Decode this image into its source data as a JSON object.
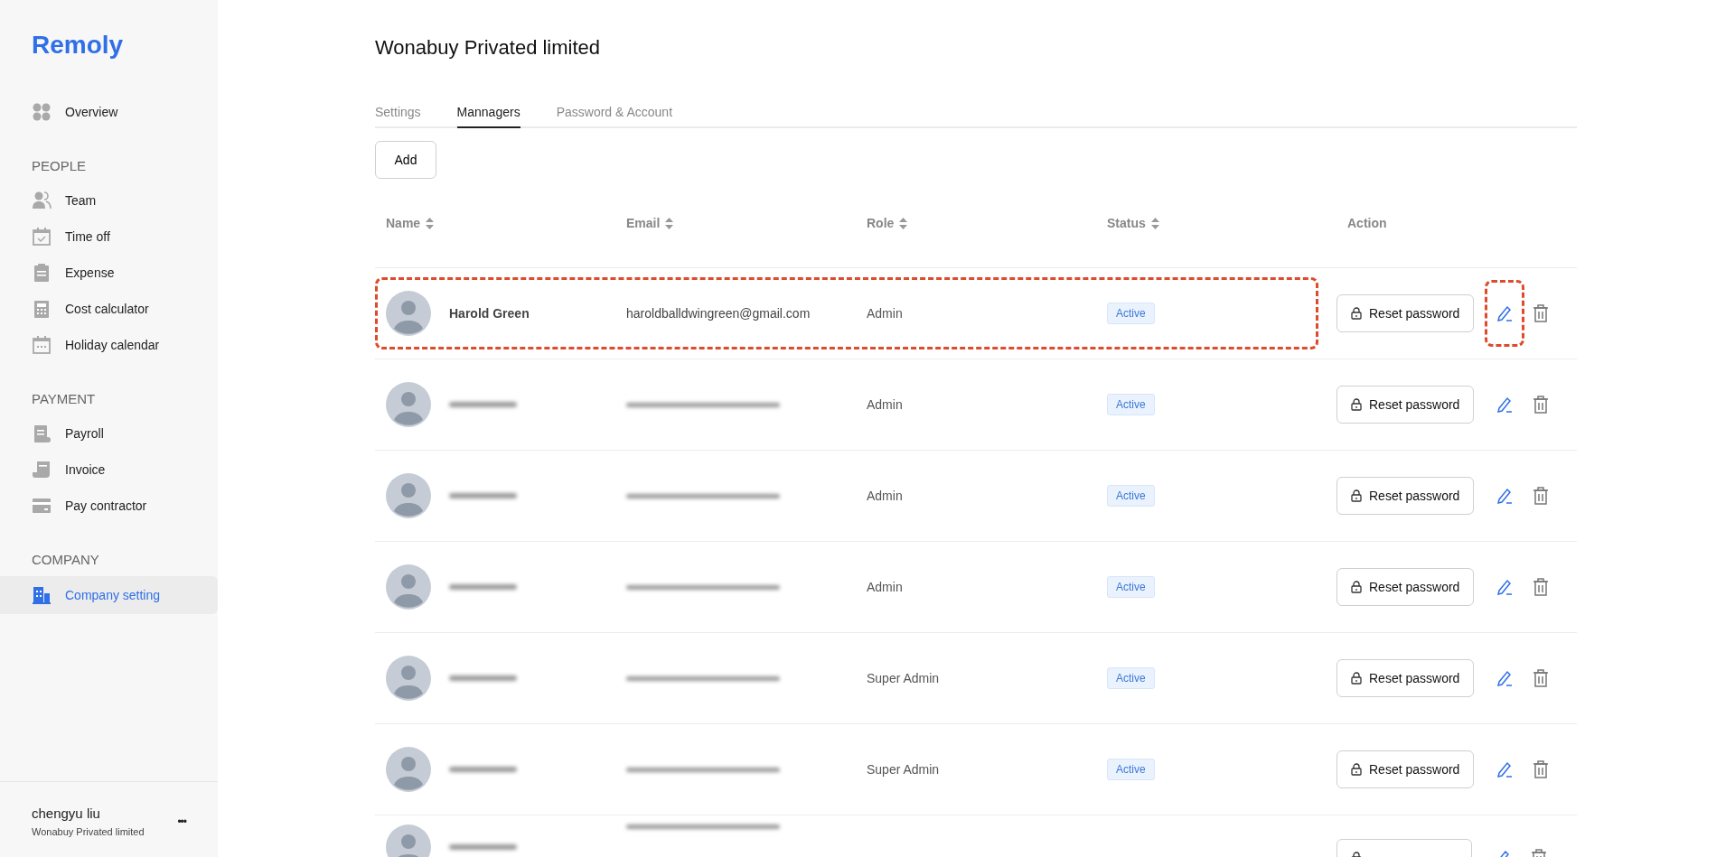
{
  "sidebar": {
    "logo": "Remoly",
    "sections": [
      {
        "items": [
          {
            "label": "Overview",
            "kind": "grid",
            "selected": false
          }
        ]
      },
      {
        "heading": "PEOPLE",
        "items": [
          {
            "label": "Team",
            "kind": "people",
            "selected": false
          },
          {
            "label": "Time off",
            "kind": "calendar-check",
            "selected": false
          },
          {
            "label": "Expense",
            "kind": "clipboard",
            "selected": false
          },
          {
            "label": "Cost calculator",
            "kind": "calculator",
            "selected": false
          },
          {
            "label": "Holiday calendar",
            "kind": "calendar",
            "selected": false
          }
        ]
      },
      {
        "heading": "PAYMENT",
        "items": [
          {
            "label": "Payroll",
            "kind": "document",
            "selected": false
          },
          {
            "label": "Invoice",
            "kind": "scroll",
            "selected": false
          },
          {
            "label": "Pay contractor",
            "kind": "card",
            "selected": false
          }
        ]
      },
      {
        "heading": "COMPANY",
        "items": [
          {
            "label": "Company setting",
            "kind": "building",
            "selected": true
          }
        ]
      }
    ],
    "user": {
      "name": "chengyu liu",
      "company": "Wonabuy Privated limited",
      "menu": "•••"
    }
  },
  "page": {
    "title": "Wonabuy Privated limited",
    "tabs": [
      {
        "label": "Settings",
        "selected": false
      },
      {
        "label": "Mannagers",
        "selected": true
      },
      {
        "label": "Password & Account",
        "selected": false
      }
    ],
    "add_button": "Add",
    "table": {
      "columns": [
        {
          "label": "Name",
          "sortable": true
        },
        {
          "label": "Email",
          "sortable": true
        },
        {
          "label": "Role",
          "sortable": true
        },
        {
          "label": "Status",
          "sortable": true
        },
        {
          "label": "Action",
          "sortable": false
        }
      ],
      "rows": [
        {
          "redacted": false,
          "name": "Harold Green",
          "email": "haroldballdwingreen@gmail.com",
          "role": "Admin",
          "status": "Active",
          "reset_label": "Reset password",
          "highlighted": true,
          "edit_highlighted": true
        },
        {
          "redacted": true,
          "role": "Admin",
          "status": "Active",
          "reset_label": "Reset password",
          "highlighted": false,
          "edit_highlighted": false
        },
        {
          "redacted": true,
          "role": "Admin",
          "status": "Active",
          "reset_label": "Reset password",
          "highlighted": false,
          "edit_highlighted": false
        },
        {
          "redacted": true,
          "role": "Admin",
          "status": "Active",
          "reset_label": "Reset password",
          "highlighted": false,
          "edit_highlighted": false
        },
        {
          "redacted": true,
          "role": "Super Admin",
          "status": "Active",
          "reset_label": "Reset password",
          "highlighted": false,
          "edit_highlighted": false
        },
        {
          "redacted": true,
          "role": "Super Admin",
          "status": "Active",
          "reset_label": "Reset password",
          "highlighted": false,
          "edit_highlighted": false
        },
        {
          "redacted": true,
          "highlighted": false,
          "edit_highlighted": false
        }
      ]
    }
  }
}
